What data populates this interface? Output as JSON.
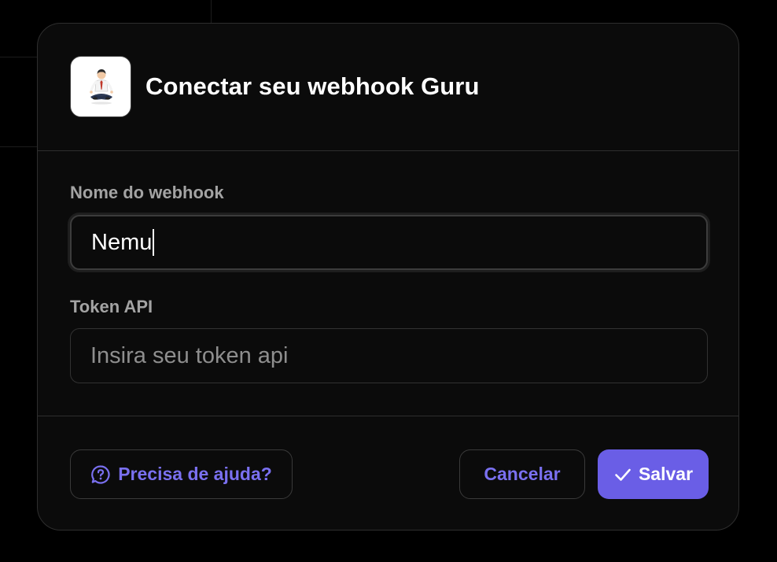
{
  "modal": {
    "title": "Conectar seu webhook Guru",
    "app_icon": "guru-meditating-person-icon"
  },
  "form": {
    "webhook_name": {
      "label": "Nome do webhook",
      "value": "Nemu"
    },
    "api_token": {
      "label": "Token API",
      "placeholder": "Insira seu token api",
      "value": ""
    }
  },
  "footer": {
    "help_label": "Precisa de ajuda?",
    "help_icon": "help-chat-icon",
    "cancel_label": "Cancelar",
    "save_label": "Salvar",
    "save_icon": "check-icon"
  },
  "colors": {
    "accent": "#6a5ee6",
    "accent_text": "#7a70f0",
    "modal_bg": "#0b0b0b",
    "page_bg": "#000000"
  }
}
